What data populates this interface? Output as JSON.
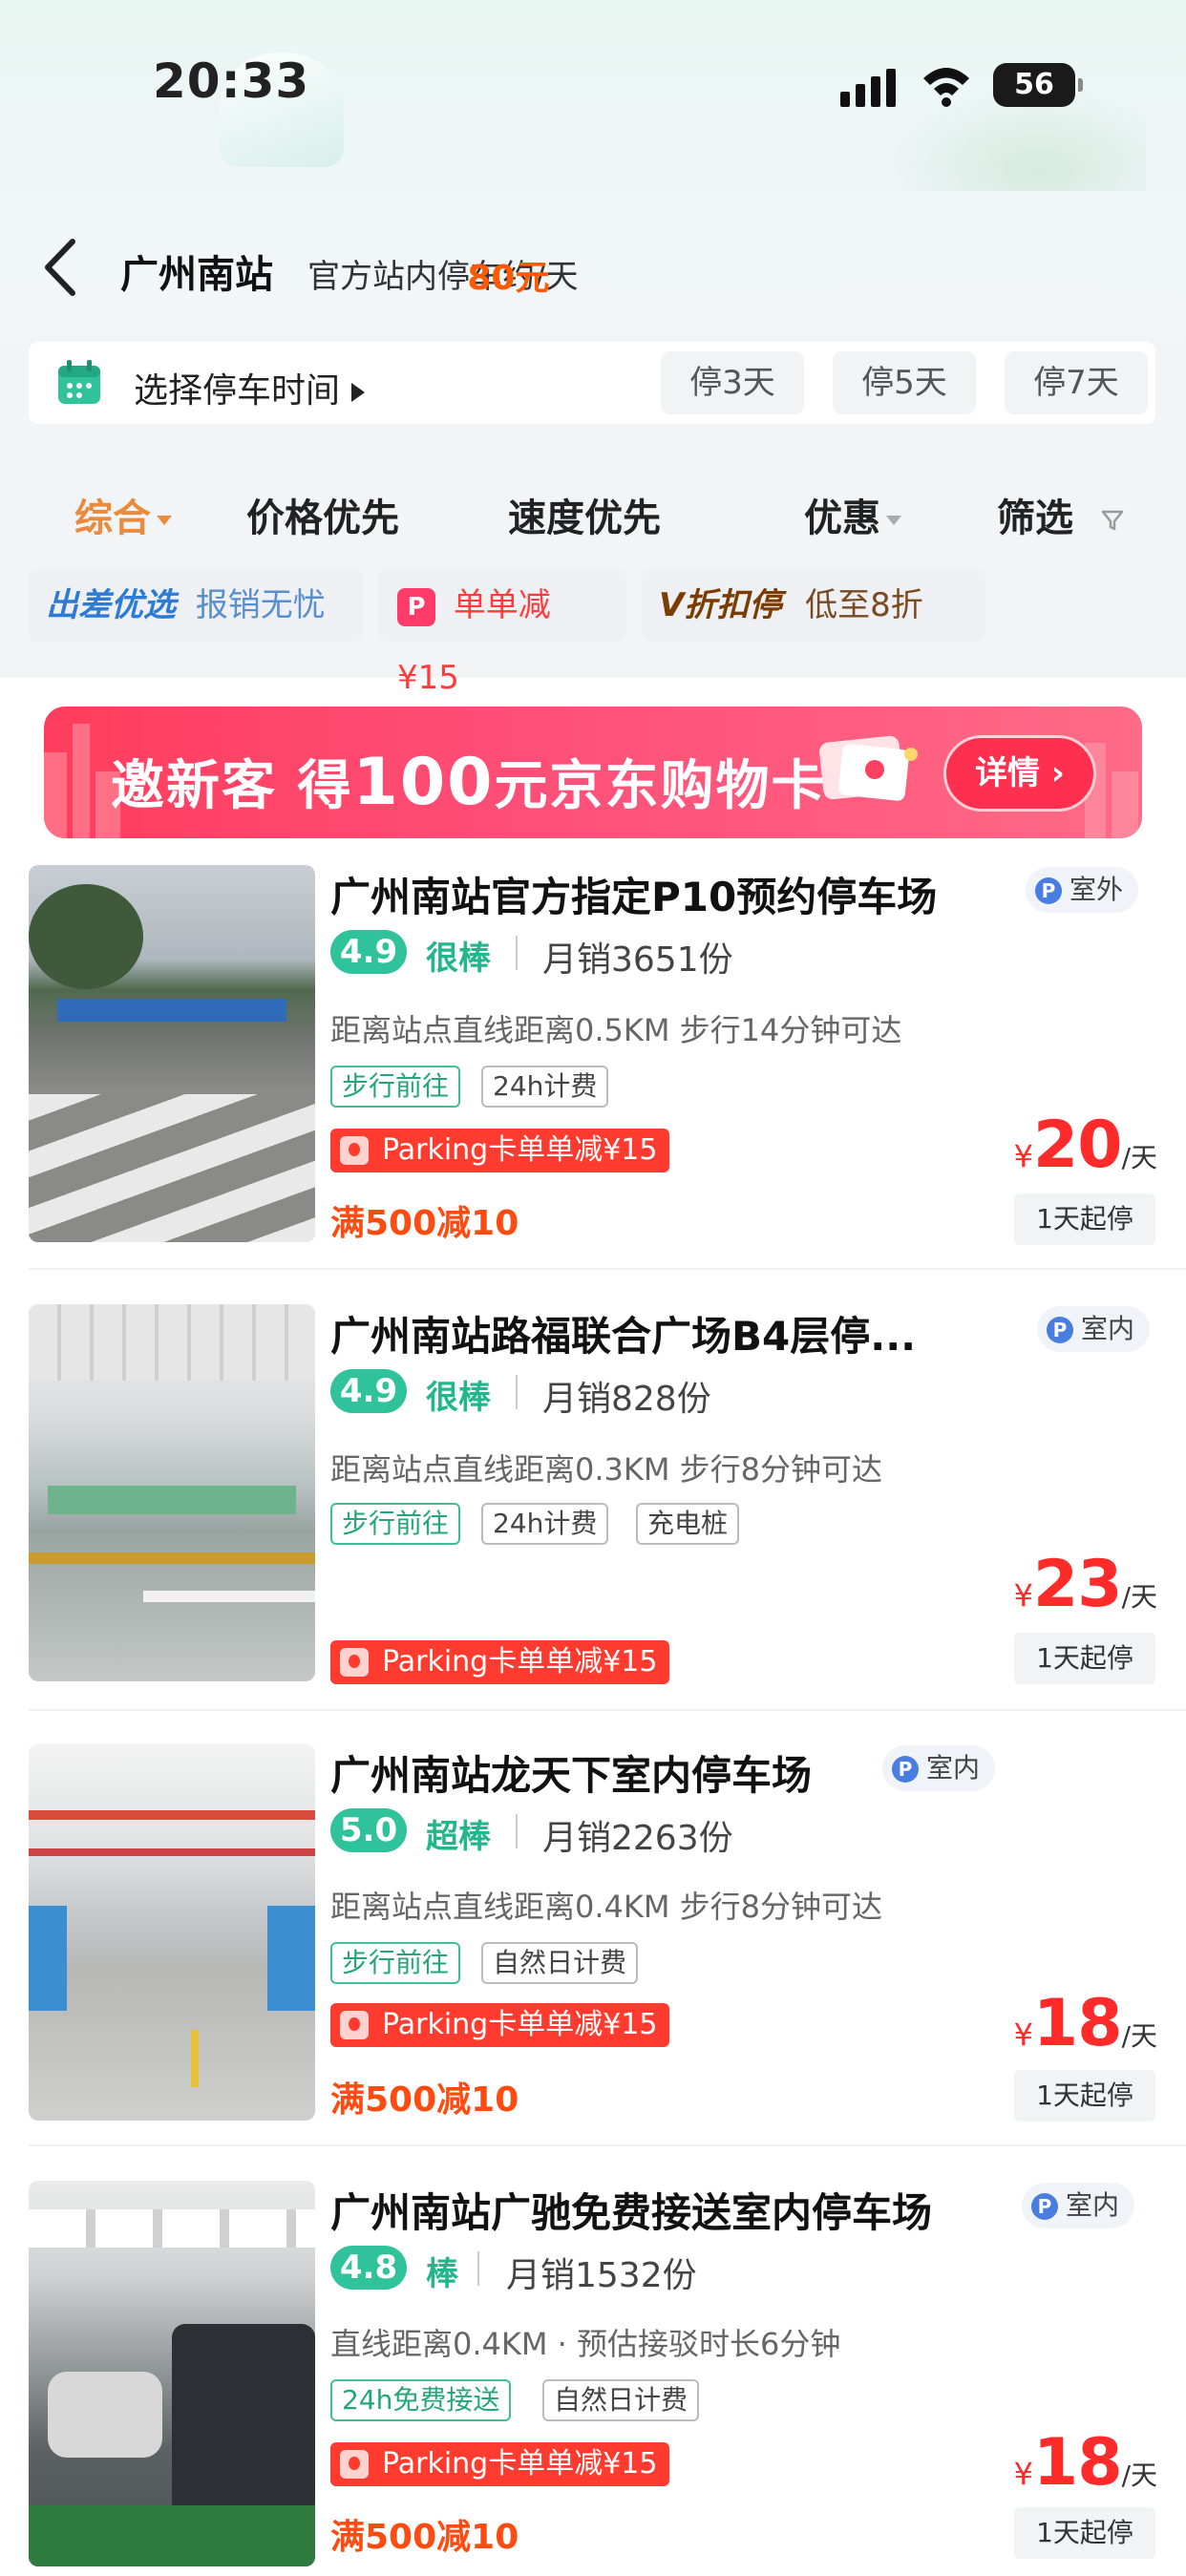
{
  "status_bar": {
    "time": "20:33",
    "battery": "56"
  },
  "header": {
    "title": "广州南站",
    "subtitle_prefix": "官方站内停车约",
    "price": "80元",
    "subtitle_suffix": "/天"
  },
  "time_picker": {
    "label": "选择停车时间",
    "chips": [
      "停3天",
      "停5天",
      "停7天"
    ]
  },
  "sort_tabs": [
    "综合",
    "价格优先",
    "速度优先",
    "优惠",
    "筛选"
  ],
  "promo_chips": [
    {
      "brand": "出差优选",
      "text": "报销无忧"
    },
    {
      "brand": "P",
      "text": "单单减¥15"
    },
    {
      "brand": "V折扣停",
      "text": "低至8折"
    }
  ],
  "banner": {
    "text_a": "邀新客 得",
    "text_b": "100",
    "text_c": "元京东购物卡",
    "button": "详情"
  },
  "lots": [
    {
      "name": "广州南站官方指定P10预约停车场",
      "location": "室外",
      "score": "4.9",
      "score_word": "很棒",
      "sales": "月销3651份",
      "distance": "距离站点直线距离0.5KM 步行14分钟可达",
      "tags": [
        "步行前往",
        "24h计费"
      ],
      "card": "Parking卡单单减¥15",
      "discount": "满500减10",
      "currency": "¥",
      "price": "20",
      "unit": "/天",
      "min_stay": "1天起停"
    },
    {
      "name": "广州南站路福联合广场B4层停...",
      "location": "室内",
      "score": "4.9",
      "score_word": "很棒",
      "sales": "月销828份",
      "distance": "距离站点直线距离0.3KM 步行8分钟可达",
      "tags": [
        "步行前往",
        "24h计费",
        "充电桩"
      ],
      "card": "Parking卡单单减¥15",
      "discount": "",
      "currency": "¥",
      "price": "23",
      "unit": "/天",
      "min_stay": "1天起停"
    },
    {
      "name": "广州南站龙天下室内停车场",
      "location": "室内",
      "score": "5.0",
      "score_word": "超棒",
      "sales": "月销2263份",
      "distance": "距离站点直线距离0.4KM 步行8分钟可达",
      "tags": [
        "步行前往",
        "自然日计费"
      ],
      "card": "Parking卡单单减¥15",
      "discount": "满500减10",
      "currency": "¥",
      "price": "18",
      "unit": "/天",
      "min_stay": "1天起停"
    },
    {
      "name": "广州南站广驰免费接送室内停车场",
      "location": "室内",
      "score": "4.8",
      "score_word": "棒",
      "sales": "月销1532份",
      "distance": "直线距离0.4KM · 预估接驳时长6分钟",
      "tags": [
        "24h免费接送",
        "自然日计费"
      ],
      "card": "Parking卡单单减¥15",
      "discount": "满500减10",
      "currency": "¥",
      "price": "18",
      "unit": "/天",
      "min_stay": "1天起停"
    }
  ],
  "colors": {
    "accent_orange": "#ff5a00",
    "score_green": "#2fc29b",
    "price_red": "#ff2a2a",
    "banner_pink": "#ff3d5d"
  }
}
